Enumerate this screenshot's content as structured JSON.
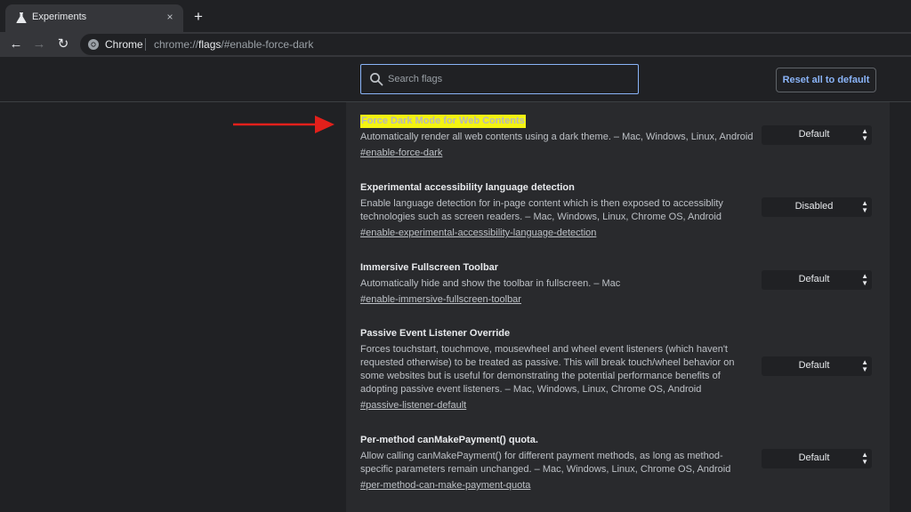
{
  "tab": {
    "title": "Experiments",
    "close_icon": "×",
    "new_tab_icon": "+"
  },
  "toolbar": {
    "back_icon": "←",
    "forward_icon": "→",
    "reload_icon": "↻",
    "site_name": "Chrome",
    "url_prefix": "chrome://",
    "url_bold": "flags",
    "url_suffix": "/#enable-force-dark"
  },
  "search": {
    "placeholder": "Search flags",
    "value": ""
  },
  "reset_label": "Reset all to default",
  "highlight_color": "#f4f411",
  "arrow_color": "#e3201b",
  "experiments": [
    {
      "title": "Force Dark Mode for Web Contents",
      "description": "Automatically render all web contents using a dark theme. – Mac, Windows, Linux, Android",
      "link": "#enable-force-dark",
      "value": "Default",
      "highlighted": true
    },
    {
      "title": "Experimental accessibility language detection",
      "description": "Enable language detection for in-page content which is then exposed to accessiblity technologies such as screen readers. – Mac, Windows, Linux, Chrome OS, Android",
      "link": "#enable-experimental-accessibility-language-detection",
      "value": "Disabled"
    },
    {
      "title": "Immersive Fullscreen Toolbar",
      "description": "Automatically hide and show the toolbar in fullscreen. – Mac",
      "link": "#enable-immersive-fullscreen-toolbar",
      "value": "Default"
    },
    {
      "title": "Passive Event Listener Override",
      "description": "Forces touchstart, touchmove, mousewheel and wheel event listeners (which haven't requested otherwise) to be treated as passive. This will break touch/wheel behavior on some websites but is useful for demonstrating the potential performance benefits of adopting passive event listeners. – Mac, Windows, Linux, Chrome OS, Android",
      "link": "#passive-listener-default",
      "value": "Default"
    },
    {
      "title": "Per-method canMakePayment() quota.",
      "description": "Allow calling canMakePayment() for different payment methods, as long as method-specific parameters remain unchanged. – Mac, Windows, Linux, Chrome OS, Android",
      "link": "#per-method-can-make-payment-quota",
      "value": "Default"
    }
  ]
}
